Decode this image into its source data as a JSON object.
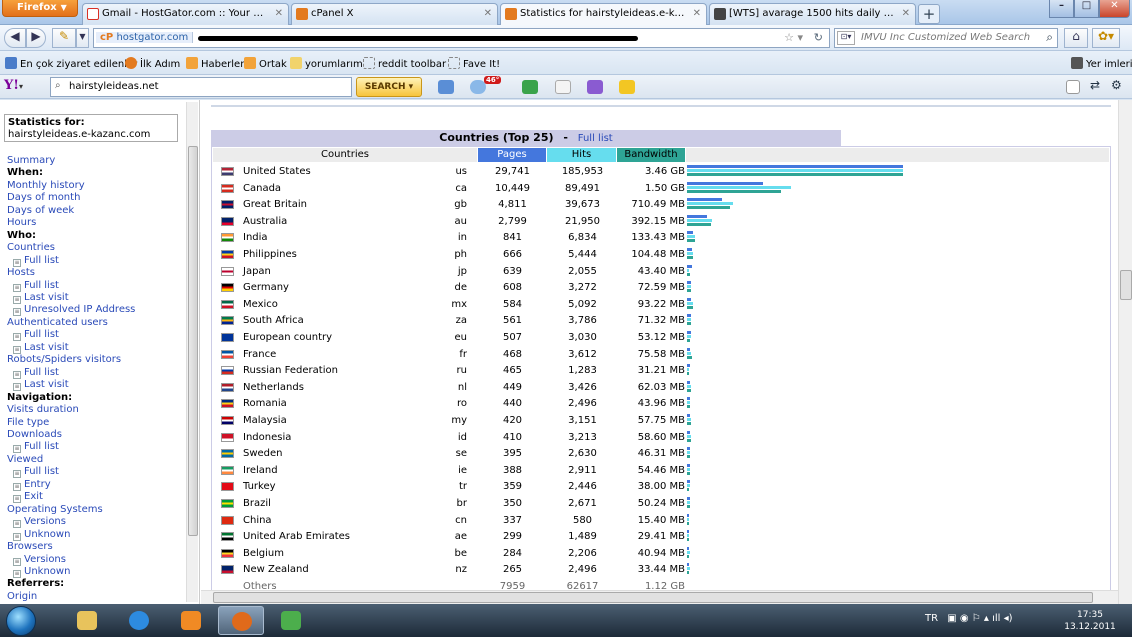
{
  "browser": {
    "menu_button": "Firefox",
    "tabs": [
      {
        "title": "Gmail - HostGator.com :: Your Accou...",
        "color": "#d93025"
      },
      {
        "title": "cPanel X",
        "color": "#e37a1f"
      },
      {
        "title": "Statistics for hairstyleideas.e-kazanc.c...",
        "color": "#e37a1f"
      },
      {
        "title": "[WTS] avarage 1500 hits daily -%100 l...",
        "color": "#333333"
      }
    ],
    "url_domain": "hostgator.com",
    "search_placeholder": "IMVU Inc Customized Web Search",
    "bookmarks": [
      "En çok ziyaret edilenler",
      "İlk Adım",
      "Haberler",
      "Ortak",
      "yorumlarım",
      "reddit toolbar",
      "Fave It!"
    ],
    "bookmarks_right": "Yer imleri",
    "yahoo": {
      "search_value": "hairstyleideas.net",
      "search_button": "SEARCH",
      "weather": "46°"
    }
  },
  "sidebar": {
    "stats_label": "Statistics for:",
    "site": "hairstyleideas.e-kazanc.com",
    "menu": [
      {
        "label": "Summary",
        "type": "link"
      },
      {
        "label": "When:",
        "type": "heading"
      },
      {
        "label": "Monthly history",
        "type": "link"
      },
      {
        "label": "Days of month",
        "type": "link"
      },
      {
        "label": "Days of week",
        "type": "link"
      },
      {
        "label": "Hours",
        "type": "link"
      },
      {
        "label": "Who:",
        "type": "heading"
      },
      {
        "label": "Countries",
        "type": "link"
      },
      {
        "label": "Full list",
        "type": "sub"
      },
      {
        "label": "Hosts",
        "type": "link"
      },
      {
        "label": "Full list",
        "type": "sub"
      },
      {
        "label": "Last visit",
        "type": "sub"
      },
      {
        "label": "Unresolved IP Address",
        "type": "sub"
      },
      {
        "label": "Authenticated users",
        "type": "link"
      },
      {
        "label": "Full list",
        "type": "sub"
      },
      {
        "label": "Last visit",
        "type": "sub"
      },
      {
        "label": "Robots/Spiders visitors",
        "type": "link"
      },
      {
        "label": "Full list",
        "type": "sub"
      },
      {
        "label": "Last visit",
        "type": "sub"
      },
      {
        "label": "Navigation:",
        "type": "heading"
      },
      {
        "label": "Visits duration",
        "type": "link"
      },
      {
        "label": "File type",
        "type": "link"
      },
      {
        "label": "Downloads",
        "type": "link"
      },
      {
        "label": "Full list",
        "type": "sub"
      },
      {
        "label": "Viewed",
        "type": "link"
      },
      {
        "label": "Full list",
        "type": "sub"
      },
      {
        "label": "Entry",
        "type": "sub"
      },
      {
        "label": "Exit",
        "type": "sub"
      },
      {
        "label": "Operating Systems",
        "type": "link"
      },
      {
        "label": "Versions",
        "type": "sub"
      },
      {
        "label": "Unknown",
        "type": "sub"
      },
      {
        "label": "Browsers",
        "type": "link"
      },
      {
        "label": "Versions",
        "type": "sub"
      },
      {
        "label": "Unknown",
        "type": "sub"
      },
      {
        "label": "Referrers:",
        "type": "heading"
      },
      {
        "label": "Origin",
        "type": "link"
      }
    ]
  },
  "countries": {
    "title": "Countries (Top 25)",
    "separator": "-",
    "full_list": "Full list",
    "headers": {
      "country": "Countries",
      "pages": "Pages",
      "hits": "Hits",
      "bandwidth": "Bandwidth"
    },
    "colors": {
      "pages": "#4477dd",
      "hits": "#66ddee",
      "bandwidth": "#2ea495",
      "header_bg": "#ececec",
      "title_bg": "#cccce6"
    },
    "rows": [
      {
        "name": "United States",
        "code": "us",
        "pages": "29,741",
        "hits": "185,953",
        "bandwidth": "3.46 GB",
        "p": 29741,
        "h": 185953,
        "bw_mb": 3543,
        "flag": [
          "#b22234",
          "#ffffff",
          "#3c3b6e"
        ]
      },
      {
        "name": "Canada",
        "code": "ca",
        "pages": "10,449",
        "hits": "89,491",
        "bandwidth": "1.50 GB",
        "p": 10449,
        "h": 89491,
        "bw_mb": 1536,
        "flag": [
          "#d52b1e",
          "#ffffff",
          "#d52b1e"
        ]
      },
      {
        "name": "Great Britain",
        "code": "gb",
        "pages": "4,811",
        "hits": "39,673",
        "bandwidth": "710.49 MB",
        "p": 4811,
        "h": 39673,
        "bw_mb": 710.49,
        "flag": [
          "#012169",
          "#c8102e",
          "#012169"
        ]
      },
      {
        "name": "Australia",
        "code": "au",
        "pages": "2,799",
        "hits": "21,950",
        "bandwidth": "392.15 MB",
        "p": 2799,
        "h": 21950,
        "bw_mb": 392.15,
        "flag": [
          "#012169",
          "#012169",
          "#e4002b"
        ]
      },
      {
        "name": "India",
        "code": "in",
        "pages": "841",
        "hits": "6,834",
        "bandwidth": "133.43 MB",
        "p": 841,
        "h": 6834,
        "bw_mb": 133.43,
        "flag": [
          "#ff9933",
          "#ffffff",
          "#138808"
        ]
      },
      {
        "name": "Philippines",
        "code": "ph",
        "pages": "666",
        "hits": "5,444",
        "bandwidth": "104.48 MB",
        "p": 666,
        "h": 5444,
        "bw_mb": 104.48,
        "flag": [
          "#0038a8",
          "#fcd116",
          "#ce1126"
        ]
      },
      {
        "name": "Japan",
        "code": "jp",
        "pages": "639",
        "hits": "2,055",
        "bandwidth": "43.40 MB",
        "p": 639,
        "h": 2055,
        "bw_mb": 43.4,
        "flag": [
          "#ffffff",
          "#bc002d",
          "#ffffff"
        ]
      },
      {
        "name": "Germany",
        "code": "de",
        "pages": "608",
        "hits": "3,272",
        "bandwidth": "72.59 MB",
        "p": 608,
        "h": 3272,
        "bw_mb": 72.59,
        "flag": [
          "#000000",
          "#dd0000",
          "#ffce00"
        ]
      },
      {
        "name": "Mexico",
        "code": "mx",
        "pages": "584",
        "hits": "5,092",
        "bandwidth": "93.22 MB",
        "p": 584,
        "h": 5092,
        "bw_mb": 93.22,
        "flag": [
          "#006847",
          "#ffffff",
          "#ce1126"
        ]
      },
      {
        "name": "South Africa",
        "code": "za",
        "pages": "561",
        "hits": "3,786",
        "bandwidth": "71.32 MB",
        "p": 561,
        "h": 3786,
        "bw_mb": 71.32,
        "flag": [
          "#007a4d",
          "#ffb612",
          "#002395"
        ]
      },
      {
        "name": "European country",
        "code": "eu",
        "pages": "507",
        "hits": "3,030",
        "bandwidth": "53.12 MB",
        "p": 507,
        "h": 3030,
        "bw_mb": 53.12,
        "flag": [
          "#003399",
          "#003399",
          "#003399"
        ]
      },
      {
        "name": "France",
        "code": "fr",
        "pages": "468",
        "hits": "3,612",
        "bandwidth": "75.58 MB",
        "p": 468,
        "h": 3612,
        "bw_mb": 75.58,
        "flag": [
          "#0055a4",
          "#ffffff",
          "#ef4135"
        ]
      },
      {
        "name": "Russian Federation",
        "code": "ru",
        "pages": "465",
        "hits": "1,283",
        "bandwidth": "31.21 MB",
        "p": 465,
        "h": 1283,
        "bw_mb": 31.21,
        "flag": [
          "#ffffff",
          "#0039a6",
          "#d52b1e"
        ]
      },
      {
        "name": "Netherlands",
        "code": "nl",
        "pages": "449",
        "hits": "3,426",
        "bandwidth": "62.03 MB",
        "p": 449,
        "h": 3426,
        "bw_mb": 62.03,
        "flag": [
          "#ae1c28",
          "#ffffff",
          "#21468b"
        ]
      },
      {
        "name": "Romania",
        "code": "ro",
        "pages": "440",
        "hits": "2,496",
        "bandwidth": "43.96 MB",
        "p": 440,
        "h": 2496,
        "bw_mb": 43.96,
        "flag": [
          "#002b7f",
          "#fcd116",
          "#ce1126"
        ]
      },
      {
        "name": "Malaysia",
        "code": "my",
        "pages": "420",
        "hits": "3,151",
        "bandwidth": "57.75 MB",
        "p": 420,
        "h": 3151,
        "bw_mb": 57.75,
        "flag": [
          "#cc0001",
          "#ffffff",
          "#010066"
        ]
      },
      {
        "name": "Indonesia",
        "code": "id",
        "pages": "410",
        "hits": "3,213",
        "bandwidth": "58.60 MB",
        "p": 410,
        "h": 3213,
        "bw_mb": 58.6,
        "flag": [
          "#ce1126",
          "#ce1126",
          "#ffffff"
        ]
      },
      {
        "name": "Sweden",
        "code": "se",
        "pages": "395",
        "hits": "2,630",
        "bandwidth": "46.31 MB",
        "p": 395,
        "h": 2630,
        "bw_mb": 46.31,
        "flag": [
          "#006aa7",
          "#fecc00",
          "#006aa7"
        ]
      },
      {
        "name": "Ireland",
        "code": "ie",
        "pages": "388",
        "hits": "2,911",
        "bandwidth": "54.46 MB",
        "p": 388,
        "h": 2911,
        "bw_mb": 54.46,
        "flag": [
          "#169b62",
          "#ffffff",
          "#ff883e"
        ]
      },
      {
        "name": "Turkey",
        "code": "tr",
        "pages": "359",
        "hits": "2,446",
        "bandwidth": "38.00 MB",
        "p": 359,
        "h": 2446,
        "bw_mb": 38.0,
        "flag": [
          "#e30a17",
          "#e30a17",
          "#e30a17"
        ]
      },
      {
        "name": "Brazil",
        "code": "br",
        "pages": "350",
        "hits": "2,671",
        "bandwidth": "50.24 MB",
        "p": 350,
        "h": 2671,
        "bw_mb": 50.24,
        "flag": [
          "#009c3b",
          "#ffdf00",
          "#009c3b"
        ]
      },
      {
        "name": "China",
        "code": "cn",
        "pages": "337",
        "hits": "580",
        "bandwidth": "15.40 MB",
        "p": 337,
        "h": 580,
        "bw_mb": 15.4,
        "flag": [
          "#de2910",
          "#de2910",
          "#de2910"
        ]
      },
      {
        "name": "United Arab Emirates",
        "code": "ae",
        "pages": "299",
        "hits": "1,489",
        "bandwidth": "29.41 MB",
        "p": 299,
        "h": 1489,
        "bw_mb": 29.41,
        "flag": [
          "#00732f",
          "#ffffff",
          "#000000"
        ]
      },
      {
        "name": "Belgium",
        "code": "be",
        "pages": "284",
        "hits": "2,206",
        "bandwidth": "40.94 MB",
        "p": 284,
        "h": 2206,
        "bw_mb": 40.94,
        "flag": [
          "#000000",
          "#fdda24",
          "#ef3340"
        ]
      },
      {
        "name": "New Zealand",
        "code": "nz",
        "pages": "265",
        "hits": "2,496",
        "bandwidth": "33.44 MB",
        "p": 265,
        "h": 2496,
        "bw_mb": 33.44,
        "flag": [
          "#012169",
          "#012169",
          "#c8102e"
        ]
      }
    ],
    "others": {
      "name": "Others",
      "pages": "7959",
      "hits": "62617",
      "bandwidth": "1.12 GB"
    }
  },
  "taskbar": {
    "lang": "TR",
    "time": "17:35",
    "date": "13.12.2011"
  }
}
